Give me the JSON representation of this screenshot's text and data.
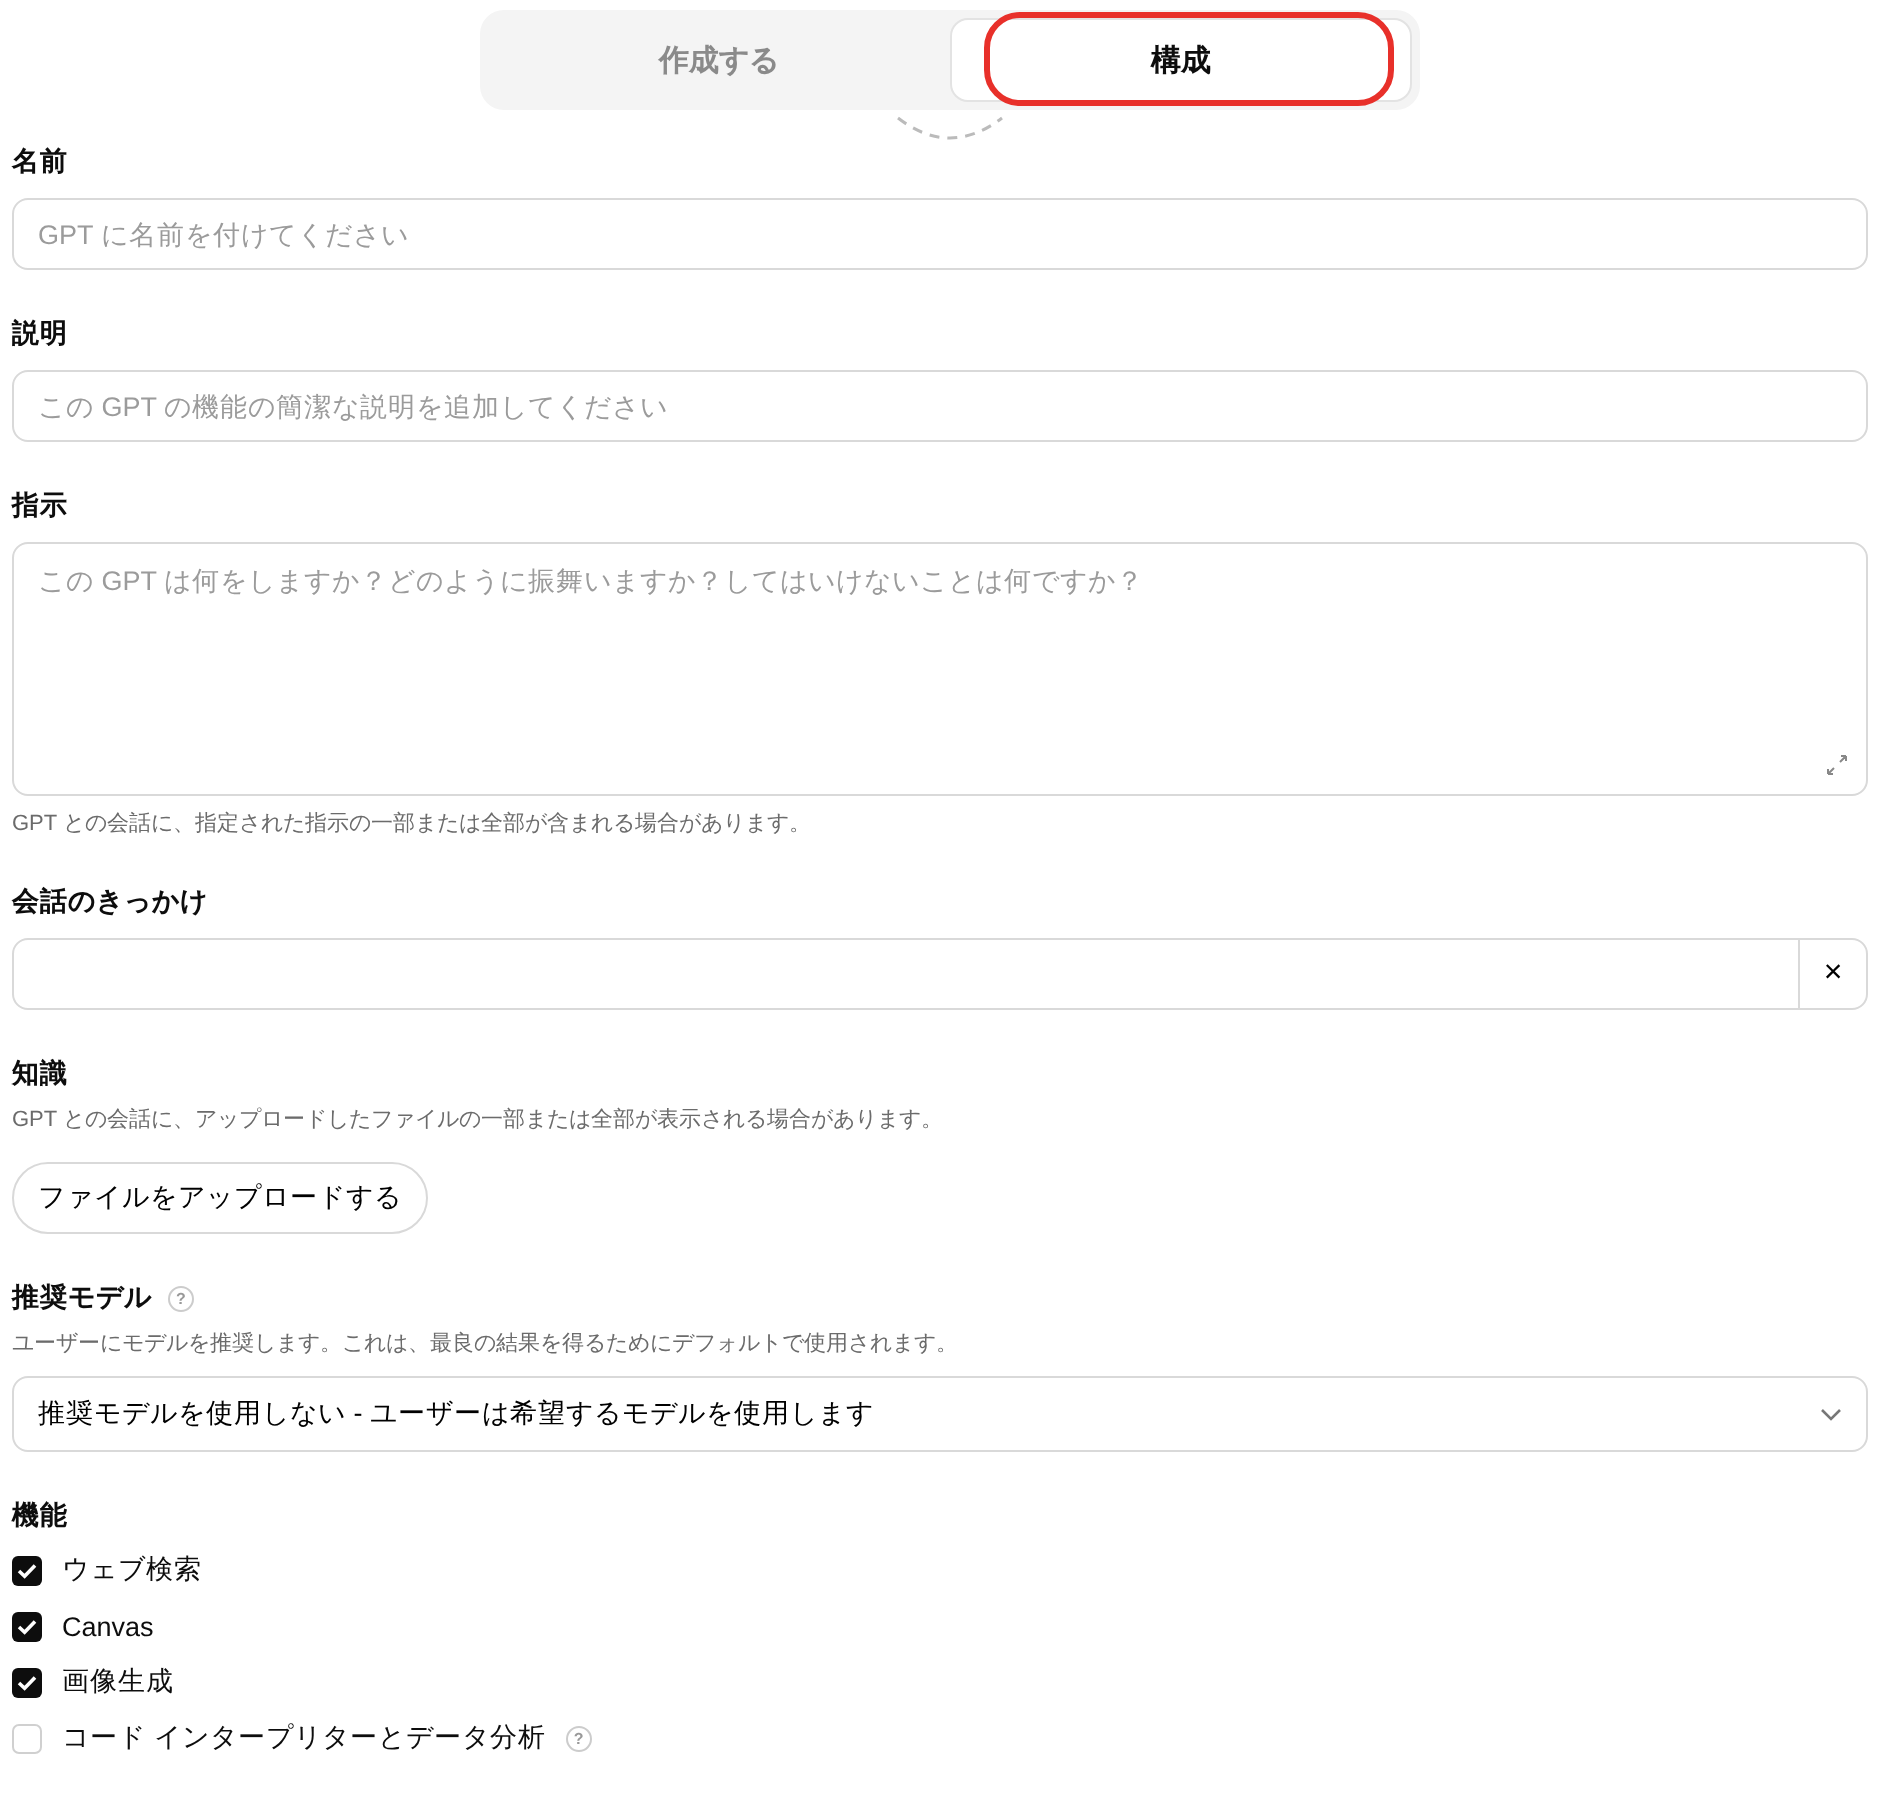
{
  "tabs": [
    {
      "label": "作成する",
      "selected": false,
      "highlighted": false
    },
    {
      "label": "構成",
      "selected": true,
      "highlighted": true
    }
  ],
  "fields": [
    {
      "kind": "input",
      "label": "名前",
      "placeholder": "GPT に名前を付けてください"
    },
    {
      "kind": "input",
      "label": "説明",
      "placeholder": "この GPT の機能の簡潔な説明を追加してください"
    },
    {
      "kind": "textarea",
      "label": "指示",
      "placeholder": "この GPT は何をしますか？どのように振舞いますか？してはいけないことは何ですか？",
      "note": "GPT との会話に、指定された指示の一部または全部が含まれる場合があります。"
    },
    {
      "kind": "starter",
      "label": "会話のきっかけ",
      "clear": "×"
    },
    {
      "kind": "upload",
      "label": "知識",
      "note": "GPT との会話に、アップロードしたファイルの一部または全部が表示される場合があります。",
      "button": "ファイルをアップロードする"
    },
    {
      "kind": "select",
      "label": "推奨モデル",
      "help": "?",
      "note": "ユーザーにモデルを推奨します。これは、最良の結果を得るためにデフォルトで使用されます。",
      "value": "推奨モデルを使用しない - ユーザーは希望するモデルを使用します"
    },
    {
      "kind": "checks",
      "label": "機能",
      "items": [
        {
          "label": "ウェブ検索",
          "checked": true
        },
        {
          "label": "Canvas",
          "checked": true
        },
        {
          "label": "画像生成",
          "checked": true
        },
        {
          "label": "コード インタープリターとデータ分析",
          "checked": false,
          "help": "?"
        }
      ]
    }
  ]
}
